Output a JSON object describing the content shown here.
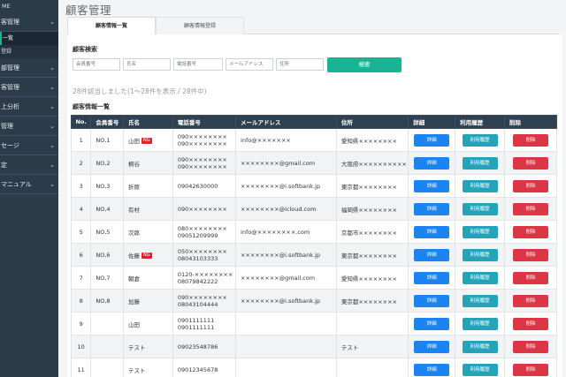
{
  "sidebar": {
    "home": "ME",
    "items": [
      {
        "label": "客管理",
        "chev": "⌄"
      },
      {
        "label": "一覧",
        "sub": true,
        "active": true
      },
      {
        "label": "登録",
        "sub": true
      },
      {
        "label": "部管理",
        "chev": "⌄"
      },
      {
        "label": "客管理",
        "chev": "⌄"
      },
      {
        "label": "上分析",
        "chev": "⌄"
      },
      {
        "label": "管理",
        "chev": "⌄"
      },
      {
        "label": "セージ",
        "chev": "⌄"
      },
      {
        "label": "定",
        "chev": "⌄"
      },
      {
        "label": "マニュアル",
        "chev": "⌄"
      }
    ]
  },
  "header": {
    "title": "顧客管理"
  },
  "tabs": [
    {
      "label": "顧客情報一覧"
    },
    {
      "label": "顧客情報登録"
    }
  ],
  "search": {
    "title": "顧客検索",
    "placeholders": [
      "会員番号",
      "氏名",
      "電話番号",
      "メールアドレス",
      "住所"
    ],
    "button": "検索"
  },
  "result_count": "28件該当しました(1〜28件を表示 / 28件中)",
  "table": {
    "title": "顧客情報一覧",
    "headers": [
      "No.",
      "会員番号",
      "氏名",
      "電話番号",
      "メールアドレス",
      "住所",
      "詳細",
      "利用履歴",
      "削除"
    ],
    "button_labels": {
      "detail": "詳細",
      "history": "利用履歴",
      "delete": "削除"
    },
    "ng_label": "NG",
    "rows": [
      {
        "no": "1",
        "member": "NO,1",
        "name": "山田",
        "ng": true,
        "phone1": "090××××××××",
        "phone2": "090××××××××",
        "email": "info@×××××××",
        "address": "愛知県××××××××"
      },
      {
        "no": "2",
        "member": "NO,2",
        "name": "桐谷",
        "ng": false,
        "phone1": "090××××××××",
        "phone2": "090××××××××",
        "email": "××××××××@gmail.com",
        "address": "大阪府××××××××××"
      },
      {
        "no": "3",
        "member": "NO,3",
        "name": "折原",
        "ng": false,
        "phone1": "09042630000",
        "phone2": "",
        "email": "××××××××@i.softbank.jp",
        "address": "東京都××××××××"
      },
      {
        "no": "4",
        "member": "NO,4",
        "name": "有村",
        "ng": false,
        "phone1": "090××××××××",
        "phone2": "",
        "email": "××××××××@icloud.com",
        "address": "福岡県××××××××"
      },
      {
        "no": "5",
        "member": "NO,5",
        "name": "次郎",
        "ng": false,
        "phone1": "080××××××××",
        "phone2": "09051209999",
        "email": "info@××××××××.com",
        "address": "京都市××××××××"
      },
      {
        "no": "6",
        "member": "NO,6",
        "name": "佐藤",
        "ng": true,
        "phone1": "050××××××××",
        "phone2": "08043103333",
        "email": "××××××××@i.softbank.jp",
        "address": "東京都××××××××"
      },
      {
        "no": "7",
        "member": "NO,7",
        "name": "朝倉",
        "ng": false,
        "phone1": "0120-××××××××",
        "phone2": "08079842222",
        "email": "××××××××@gmail.com",
        "address": "愛知県××××××××"
      },
      {
        "no": "8",
        "member": "NO,8",
        "name": "加藤",
        "ng": false,
        "phone1": "090××××××××",
        "phone2": "08043104444",
        "email": "××××××××@i.softbank.jp",
        "address": "東京都××××××××"
      },
      {
        "no": "9",
        "member": "",
        "name": "山田",
        "ng": false,
        "phone1": "0901111111",
        "phone2": "0901111111",
        "email": "",
        "address": ""
      },
      {
        "no": "10",
        "member": "",
        "name": "テスト",
        "ng": false,
        "phone1": "09023548786",
        "phone2": "",
        "email": "",
        "address": "テスト"
      },
      {
        "no": "11",
        "member": "",
        "name": "テスト",
        "ng": false,
        "phone1": "09012345678",
        "phone2": "",
        "email": "",
        "address": ""
      }
    ]
  },
  "colors": {
    "sidebar": "#2c3b4a",
    "accent": "#1ab394",
    "header_row": "#2f4050",
    "detail": "#1c84f0",
    "history": "#23a4b8",
    "delete": "#dc3545"
  }
}
